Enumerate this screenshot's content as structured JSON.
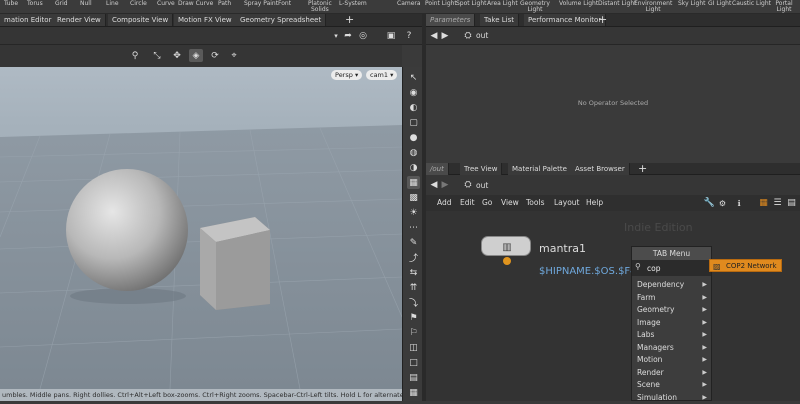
{
  "shelf": {
    "tools": [
      "Tube",
      "Torus",
      "Grid",
      "Null",
      "Line",
      "Circle",
      "Curve",
      "Draw Curve",
      "Path",
      "Spray Paint",
      "Font",
      "Platonic\nSolids",
      "L-System"
    ],
    "lights": [
      "Camera",
      "Point Light",
      "Spot Light",
      "Area Light",
      "Geometry\nLight",
      "Volume Light",
      "Distant Light",
      "Environment\nLight",
      "Sky Light",
      "GI Light",
      "Caustic Light",
      "Portal Light"
    ]
  },
  "left_tabs": [
    "mation Editor",
    "Render View",
    "Composite View",
    "Motion FX View",
    "Geometry Spreadsheet"
  ],
  "right_tabs_top": [
    "Parameters",
    "Take List",
    "Performance Monitor"
  ],
  "params": {
    "path": "out",
    "empty_message": "No Operator Selected"
  },
  "viewport": {
    "persp_label": "Persp ▾",
    "cam_label": "cam1 ▾",
    "status_text": "umbles. Middle pans. Right dollies. Ctrl+Alt+Left box-zooms. Ctrl+Right zooms. Spacebar-Ctrl-Left tilts. Hold L for alternate"
  },
  "net": {
    "tabs": [
      "/out",
      "Tree View",
      "Material Palette",
      "Asset Browser"
    ],
    "path": "out",
    "menu": [
      "Add",
      "Edit",
      "Go",
      "View",
      "Tools",
      "Layout",
      "Help"
    ],
    "watermark": "Indie Edition",
    "node": {
      "name": "mantra1",
      "output": "$HIPNAME.$OS.$F4.e"
    }
  },
  "tab_menu": {
    "title": "TAB Menu",
    "search_value": "cop",
    "items": [
      "Dependency",
      "Farm",
      "Geometry",
      "Image",
      "Labs",
      "Managers",
      "Motion",
      "Render",
      "Scene",
      "Simulation"
    ],
    "result": "COP2 Network"
  },
  "colors": {
    "accent": "#e08a1e",
    "param_header": "#c0c0c0"
  }
}
